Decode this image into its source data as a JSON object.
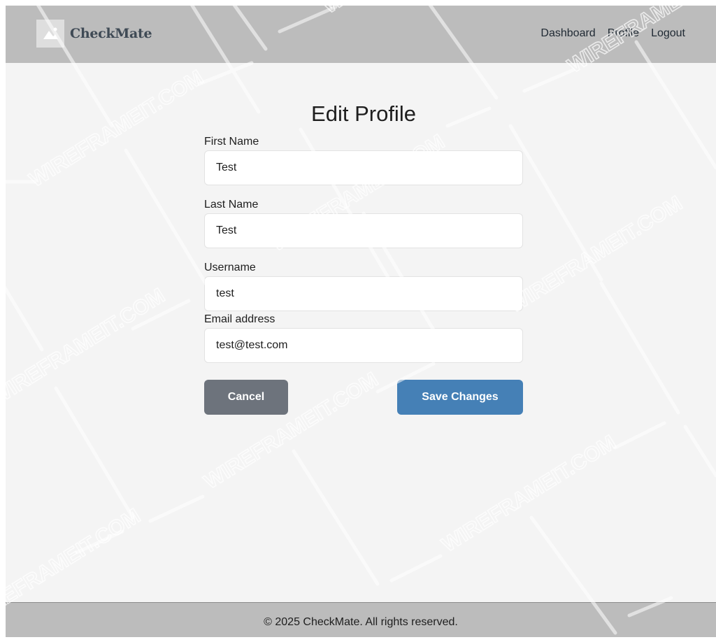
{
  "app": {
    "brand_name": "CheckMate"
  },
  "nav": {
    "items": [
      "Dashboard",
      "Profile",
      "Logout"
    ]
  },
  "form": {
    "title": "Edit Profile",
    "fields": [
      {
        "label": "First Name",
        "value": "Test"
      },
      {
        "label": "Last Name",
        "value": "Test"
      },
      {
        "label": "Username",
        "value": "test"
      },
      {
        "label": "Email address",
        "value": "test@test.com"
      }
    ],
    "cancel_label": "Cancel",
    "save_label": "Save Changes"
  },
  "footer": {
    "text": "© 2025 CheckMate. All rights reserved."
  },
  "watermark": {
    "text": "WIREFRAMEIT.COM"
  },
  "colors": {
    "header_bg": "#bcbcbc",
    "page_bg": "#f4f4f4",
    "cancel_button": "#6d737c",
    "save_button": "#4580b6",
    "brand_text": "#3f4a55"
  },
  "icons": {
    "logo": "image-placeholder-icon"
  }
}
